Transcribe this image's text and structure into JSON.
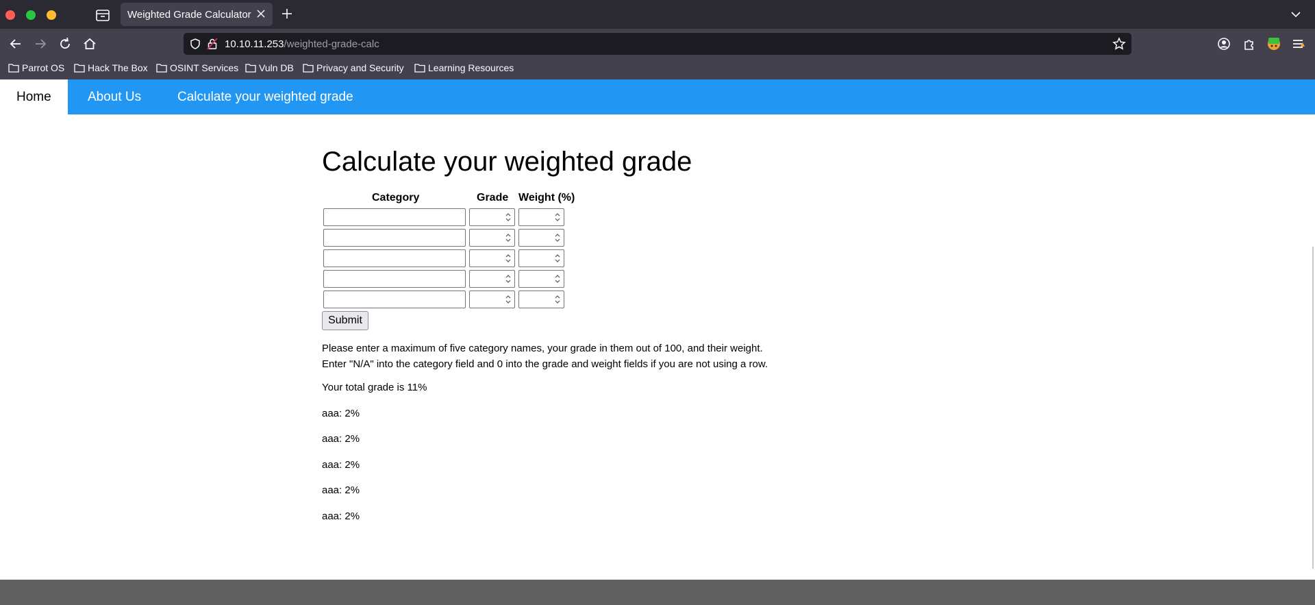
{
  "browser": {
    "tab_title": "Weighted Grade Calculator",
    "url_host": "10.10.11.253",
    "url_path": "/weighted-grade-calc",
    "bookmarks": [
      "Parrot OS",
      "Hack The Box",
      "OSINT Services",
      "Vuln DB",
      "Privacy and Security",
      "Learning Resources"
    ],
    "colors": {
      "chrome_dark": "#2b2a33",
      "chrome": "#42414d",
      "urlbar": "#1c1b22"
    }
  },
  "site_nav": {
    "items": [
      "Home",
      "About Us",
      "Calculate your weighted grade"
    ],
    "active": "Home",
    "color": "#2196f3"
  },
  "page": {
    "title": "Calculate your weighted grade",
    "columns": {
      "category": "Category",
      "grade": "Grade",
      "weight": "Weight (%)"
    },
    "rows": [
      {
        "category": "",
        "grade": "",
        "weight": ""
      },
      {
        "category": "",
        "grade": "",
        "weight": ""
      },
      {
        "category": "",
        "grade": "",
        "weight": ""
      },
      {
        "category": "",
        "grade": "",
        "weight": ""
      },
      {
        "category": "",
        "grade": "",
        "weight": ""
      }
    ],
    "submit_label": "Submit",
    "instructions_line1": "Please enter a maximum of five category names, your grade in them out of 100, and their weight.",
    "instructions_line2": "Enter \"N/A\" into the category field and 0 into the grade and weight fields if you are not using a row.",
    "total": "Your total grade is 11%",
    "results": [
      "aaa: 2%",
      "aaa: 2%",
      "aaa: 2%",
      "aaa: 2%",
      "aaa: 2%"
    ]
  }
}
